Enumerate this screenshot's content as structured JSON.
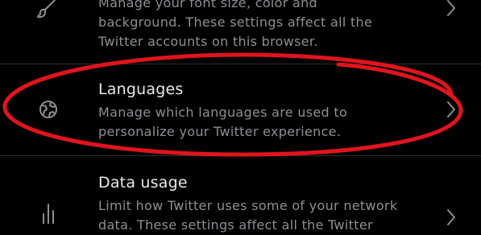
{
  "settings": {
    "items": [
      {
        "id": "display",
        "desc_lines": [
          "Manage your font size, color and",
          "background. These settings affect all the",
          "Twitter accounts on this browser."
        ],
        "icon": "brush-icon"
      },
      {
        "id": "languages",
        "title": "Languages",
        "desc_lines": [
          "Manage which languages are used to",
          "personalize your Twitter experience."
        ],
        "icon": "globe-icon"
      },
      {
        "id": "data-usage",
        "title": "Data usage",
        "desc_lines": [
          "Limit how Twitter uses some of your network",
          "data. These settings affect all the Twitter"
        ],
        "icon": "bar-chart-icon"
      }
    ]
  },
  "colors": {
    "background": "#000000",
    "title": "#e7e9ea",
    "description": "#8b8f94",
    "divider": "#2b2f33",
    "annotation": "#e0141e"
  }
}
